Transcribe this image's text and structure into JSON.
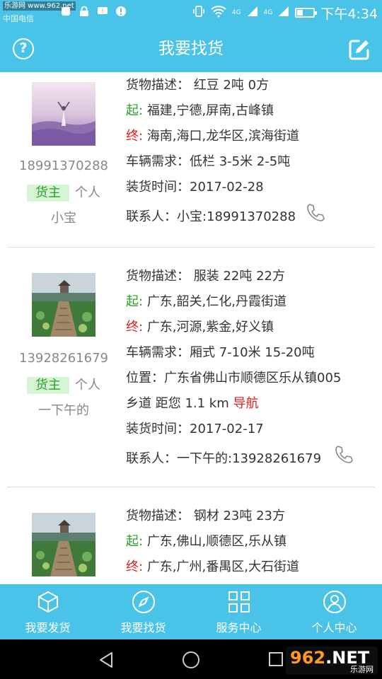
{
  "status_bar": {
    "watermark": "乐游网 www.962.net",
    "carrier": "中国电信",
    "network_top": "4G",
    "network_bottom": "4G",
    "time": "下午4:34"
  },
  "header": {
    "title": "我要找货",
    "help_icon": "question-circle-icon",
    "edit_icon": "edit-icon"
  },
  "labels": {
    "desc": "货物描述：",
    "start": "起:",
    "end": "终:",
    "vehicle": "车辆需求：",
    "location": "位置：",
    "load_time": "装货时间：",
    "contact": "联系人：",
    "navigate": "导航"
  },
  "listings": [
    {
      "phone": "18991370288",
      "role": "货主",
      "role_type": "个人",
      "nickname": "小宝",
      "desc": "红豆  2吨  0方",
      "start": "福建,宁德,屏南,古峰镇",
      "end": "海南,海口,龙华区,滨海街道",
      "vehicle": "低栏  3-5米  2-5吨",
      "load_time": "2017-02-28",
      "contact": "小宝:18991370288"
    },
    {
      "phone": "13928261679",
      "role": "货主",
      "role_type": "个人",
      "nickname": "一下午的",
      "desc": "服装  22吨  22方",
      "start": "广东,韶关,仁化,丹霞街道",
      "end": "广东,河源,紫金,好义镇",
      "vehicle": "厢式  7-10米  15-20吨",
      "location_line1": "广东省佛山市顺德区乐从镇005",
      "location_line2": "乡道  距您 1.1 km",
      "load_time": "2017-02-17",
      "contact": "一下午的:13928261679"
    },
    {
      "desc": "钢材  23吨  23方",
      "start": "广东,佛山,顺德区,乐从镇",
      "end": "广东,广州,番禺区,大石街道"
    }
  ],
  "tabs": [
    {
      "label": "我要发货",
      "icon": "box-icon"
    },
    {
      "label": "我要找货",
      "icon": "compass-icon"
    },
    {
      "label": "服务中心",
      "icon": "grid-icon"
    },
    {
      "label": "个人中心",
      "icon": "user-icon"
    }
  ],
  "watermark_logo": {
    "big_a": "962",
    "big_b": ".NET",
    "sub": "乐游网"
  },
  "colors": {
    "accent": "#4ac3e8",
    "start_green": "#2aa02a",
    "end_red": "#e02020",
    "badge_bg": "#d5f5d5"
  }
}
